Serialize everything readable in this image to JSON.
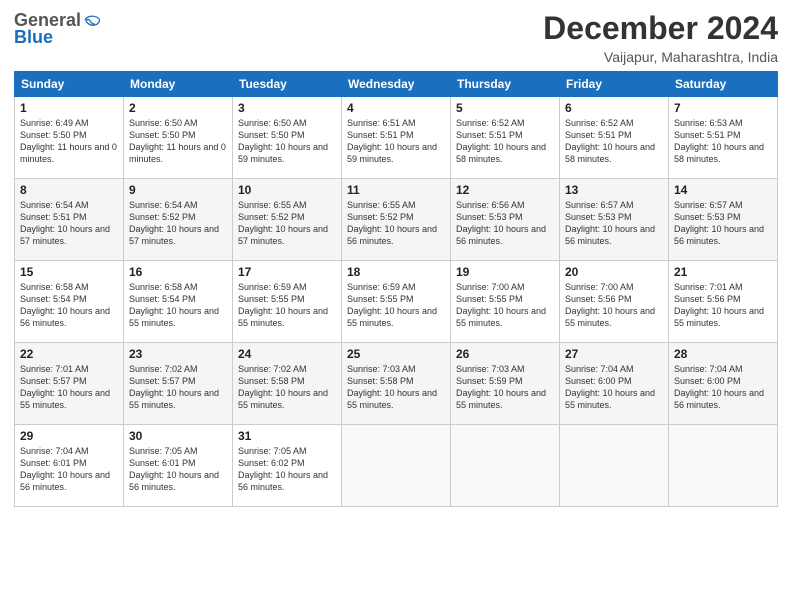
{
  "header": {
    "logo": {
      "general": "General",
      "blue": "Blue"
    },
    "title": "December 2024",
    "location": "Vaijapur, Maharashtra, India"
  },
  "calendar": {
    "headers": [
      "Sunday",
      "Monday",
      "Tuesday",
      "Wednesday",
      "Thursday",
      "Friday",
      "Saturday"
    ],
    "weeks": [
      [
        {
          "day": "1",
          "sunrise": "Sunrise: 6:49 AM",
          "sunset": "Sunset: 5:50 PM",
          "daylight": "Daylight: 11 hours and 0 minutes."
        },
        {
          "day": "2",
          "sunrise": "Sunrise: 6:50 AM",
          "sunset": "Sunset: 5:50 PM",
          "daylight": "Daylight: 11 hours and 0 minutes."
        },
        {
          "day": "3",
          "sunrise": "Sunrise: 6:50 AM",
          "sunset": "Sunset: 5:50 PM",
          "daylight": "Daylight: 10 hours and 59 minutes."
        },
        {
          "day": "4",
          "sunrise": "Sunrise: 6:51 AM",
          "sunset": "Sunset: 5:51 PM",
          "daylight": "Daylight: 10 hours and 59 minutes."
        },
        {
          "day": "5",
          "sunrise": "Sunrise: 6:52 AM",
          "sunset": "Sunset: 5:51 PM",
          "daylight": "Daylight: 10 hours and 58 minutes."
        },
        {
          "day": "6",
          "sunrise": "Sunrise: 6:52 AM",
          "sunset": "Sunset: 5:51 PM",
          "daylight": "Daylight: 10 hours and 58 minutes."
        },
        {
          "day": "7",
          "sunrise": "Sunrise: 6:53 AM",
          "sunset": "Sunset: 5:51 PM",
          "daylight": "Daylight: 10 hours and 58 minutes."
        }
      ],
      [
        {
          "day": "8",
          "sunrise": "Sunrise: 6:54 AM",
          "sunset": "Sunset: 5:51 PM",
          "daylight": "Daylight: 10 hours and 57 minutes."
        },
        {
          "day": "9",
          "sunrise": "Sunrise: 6:54 AM",
          "sunset": "Sunset: 5:52 PM",
          "daylight": "Daylight: 10 hours and 57 minutes."
        },
        {
          "day": "10",
          "sunrise": "Sunrise: 6:55 AM",
          "sunset": "Sunset: 5:52 PM",
          "daylight": "Daylight: 10 hours and 57 minutes."
        },
        {
          "day": "11",
          "sunrise": "Sunrise: 6:55 AM",
          "sunset": "Sunset: 5:52 PM",
          "daylight": "Daylight: 10 hours and 56 minutes."
        },
        {
          "day": "12",
          "sunrise": "Sunrise: 6:56 AM",
          "sunset": "Sunset: 5:53 PM",
          "daylight": "Daylight: 10 hours and 56 minutes."
        },
        {
          "day": "13",
          "sunrise": "Sunrise: 6:57 AM",
          "sunset": "Sunset: 5:53 PM",
          "daylight": "Daylight: 10 hours and 56 minutes."
        },
        {
          "day": "14",
          "sunrise": "Sunrise: 6:57 AM",
          "sunset": "Sunset: 5:53 PM",
          "daylight": "Daylight: 10 hours and 56 minutes."
        }
      ],
      [
        {
          "day": "15",
          "sunrise": "Sunrise: 6:58 AM",
          "sunset": "Sunset: 5:54 PM",
          "daylight": "Daylight: 10 hours and 56 minutes."
        },
        {
          "day": "16",
          "sunrise": "Sunrise: 6:58 AM",
          "sunset": "Sunset: 5:54 PM",
          "daylight": "Daylight: 10 hours and 55 minutes."
        },
        {
          "day": "17",
          "sunrise": "Sunrise: 6:59 AM",
          "sunset": "Sunset: 5:55 PM",
          "daylight": "Daylight: 10 hours and 55 minutes."
        },
        {
          "day": "18",
          "sunrise": "Sunrise: 6:59 AM",
          "sunset": "Sunset: 5:55 PM",
          "daylight": "Daylight: 10 hours and 55 minutes."
        },
        {
          "day": "19",
          "sunrise": "Sunrise: 7:00 AM",
          "sunset": "Sunset: 5:55 PM",
          "daylight": "Daylight: 10 hours and 55 minutes."
        },
        {
          "day": "20",
          "sunrise": "Sunrise: 7:00 AM",
          "sunset": "Sunset: 5:56 PM",
          "daylight": "Daylight: 10 hours and 55 minutes."
        },
        {
          "day": "21",
          "sunrise": "Sunrise: 7:01 AM",
          "sunset": "Sunset: 5:56 PM",
          "daylight": "Daylight: 10 hours and 55 minutes."
        }
      ],
      [
        {
          "day": "22",
          "sunrise": "Sunrise: 7:01 AM",
          "sunset": "Sunset: 5:57 PM",
          "daylight": "Daylight: 10 hours and 55 minutes."
        },
        {
          "day": "23",
          "sunrise": "Sunrise: 7:02 AM",
          "sunset": "Sunset: 5:57 PM",
          "daylight": "Daylight: 10 hours and 55 minutes."
        },
        {
          "day": "24",
          "sunrise": "Sunrise: 7:02 AM",
          "sunset": "Sunset: 5:58 PM",
          "daylight": "Daylight: 10 hours and 55 minutes."
        },
        {
          "day": "25",
          "sunrise": "Sunrise: 7:03 AM",
          "sunset": "Sunset: 5:58 PM",
          "daylight": "Daylight: 10 hours and 55 minutes."
        },
        {
          "day": "26",
          "sunrise": "Sunrise: 7:03 AM",
          "sunset": "Sunset: 5:59 PM",
          "daylight": "Daylight: 10 hours and 55 minutes."
        },
        {
          "day": "27",
          "sunrise": "Sunrise: 7:04 AM",
          "sunset": "Sunset: 6:00 PM",
          "daylight": "Daylight: 10 hours and 55 minutes."
        },
        {
          "day": "28",
          "sunrise": "Sunrise: 7:04 AM",
          "sunset": "Sunset: 6:00 PM",
          "daylight": "Daylight: 10 hours and 56 minutes."
        }
      ],
      [
        {
          "day": "29",
          "sunrise": "Sunrise: 7:04 AM",
          "sunset": "Sunset: 6:01 PM",
          "daylight": "Daylight: 10 hours and 56 minutes."
        },
        {
          "day": "30",
          "sunrise": "Sunrise: 7:05 AM",
          "sunset": "Sunset: 6:01 PM",
          "daylight": "Daylight: 10 hours and 56 minutes."
        },
        {
          "day": "31",
          "sunrise": "Sunrise: 7:05 AM",
          "sunset": "Sunset: 6:02 PM",
          "daylight": "Daylight: 10 hours and 56 minutes."
        },
        null,
        null,
        null,
        null
      ]
    ]
  }
}
